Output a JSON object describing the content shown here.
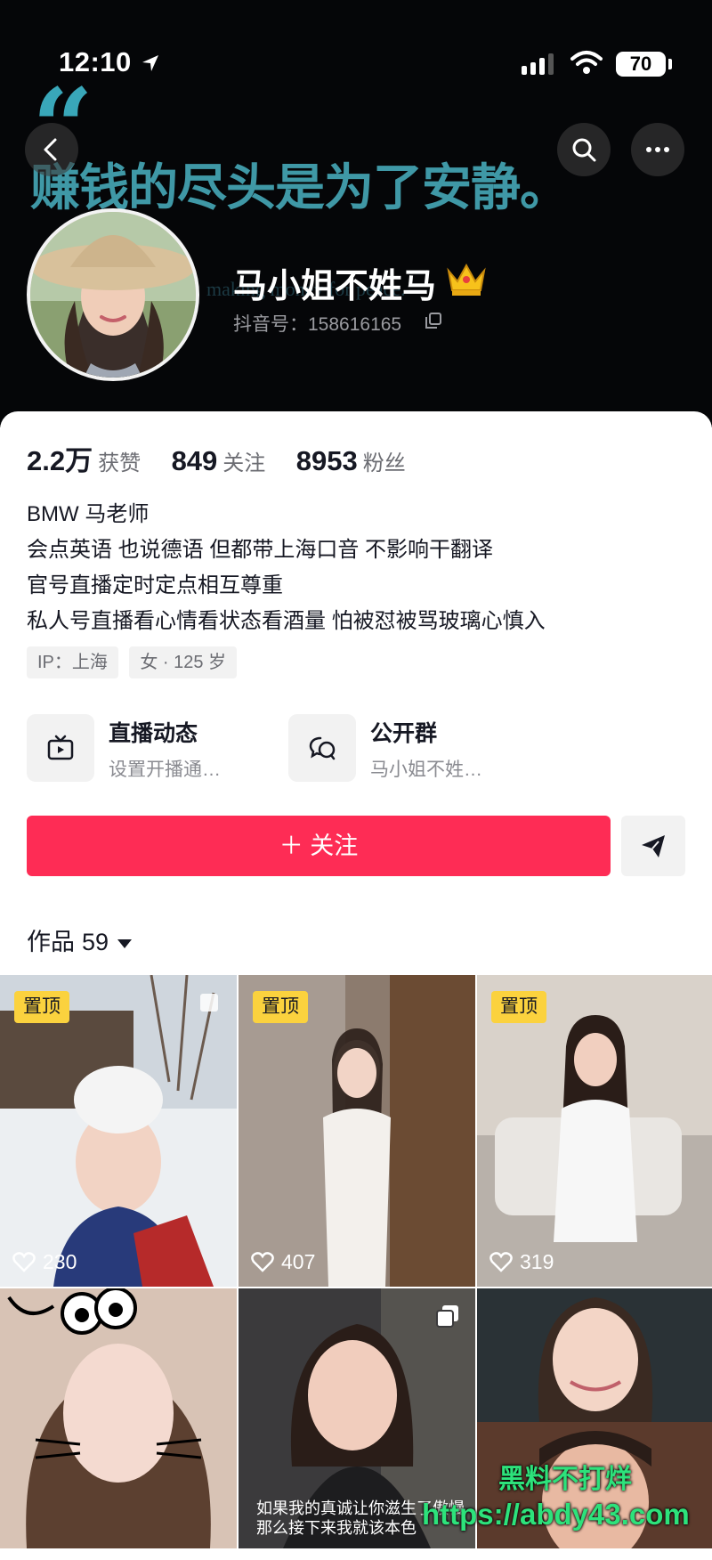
{
  "status_bar": {
    "time": "12:10",
    "battery": "70"
  },
  "header": {
    "quote_mark": "“",
    "banner_text": "赚钱的尽头是为了安静。",
    "banner_subtext": "making money for peace.",
    "nickname": "马小姐不姓马",
    "douyin_id": "抖音号：158616165"
  },
  "stats": [
    {
      "value": "2.2万",
      "label": "获赞"
    },
    {
      "value": "849",
      "label": "关注"
    },
    {
      "value": "8953",
      "label": "粉丝"
    }
  ],
  "bio": [
    "BMW 马老师",
    "会点英语 也说德语 但都带上海口音 不影响干翻译",
    "官号直播定时定点相互尊重",
    "私人号直播看心情看状态看酒量 怕被怼被骂玻璃心慎入"
  ],
  "tags": {
    "ip": "IP：上海",
    "gender_age": "女 · 125 岁"
  },
  "entries": {
    "live": {
      "title": "直播动态",
      "subtitle": "设置开播通…"
    },
    "group": {
      "title": "公开群",
      "subtitle": "马小姐不姓…"
    }
  },
  "follow_button": "＋ 关注",
  "works": {
    "label": "作品",
    "count": "59"
  },
  "videos": [
    {
      "pinned": true,
      "pin_label": "置顶",
      "likes": "230"
    },
    {
      "pinned": true,
      "pin_label": "置顶",
      "likes": "407"
    },
    {
      "pinned": true,
      "pin_label": "置顶",
      "likes": "319"
    },
    {
      "pinned": false,
      "likes": ""
    },
    {
      "pinned": false,
      "likes": "",
      "caption_1": "如果我的真诚让你滋生了傲慢",
      "caption_2": "那么接下来我就该本色"
    },
    {
      "pinned": false,
      "likes": ""
    }
  ],
  "watermark": {
    "line1": "黑料不打烊",
    "line2": "https://abdy43.com"
  },
  "colors": {
    "accent": "#fe2c55",
    "pin": "#fbd23e",
    "banner": "#3f98a6"
  }
}
